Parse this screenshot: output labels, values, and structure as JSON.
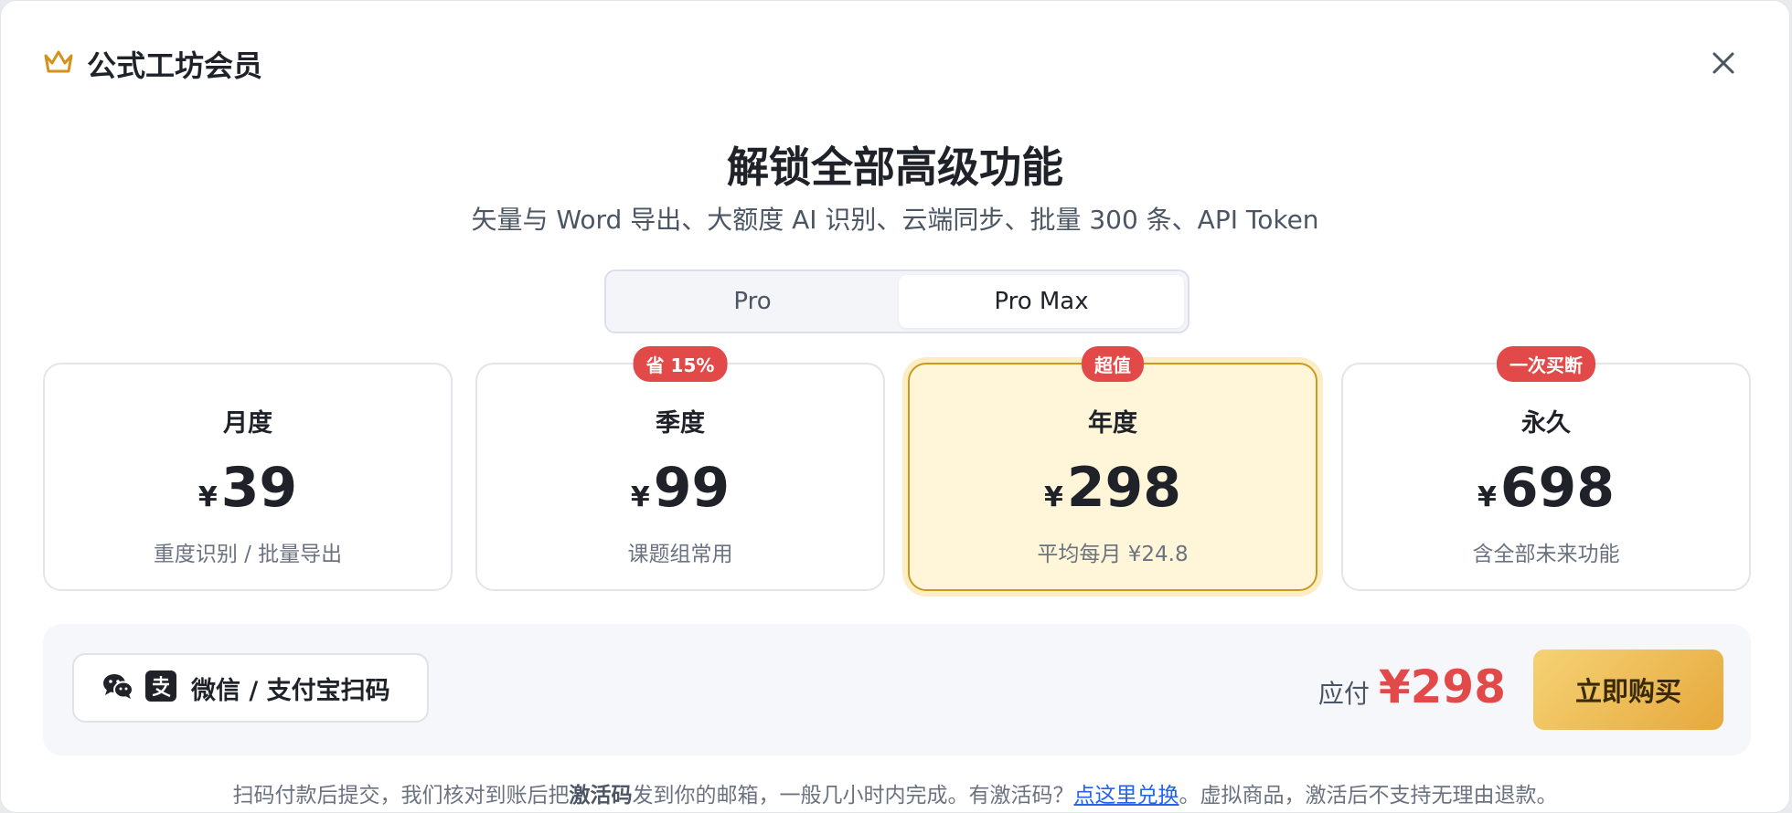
{
  "header": {
    "title": "公式工坊会员",
    "icon": "crown-icon",
    "accent": "#d4921a"
  },
  "hero": {
    "title": "解锁全部高级功能",
    "subtitle": "矢量与 Word 导出、大额度 AI 识别、云端同步、批量 300 条、API Token"
  },
  "tiers": [
    {
      "label": "Pro",
      "active": false
    },
    {
      "label": "Pro Max",
      "active": true
    }
  ],
  "plans": [
    {
      "name": "月度",
      "currency": "¥",
      "price": "39",
      "desc": "重度识别 / 批量导出",
      "badge": "",
      "selected": false
    },
    {
      "name": "季度",
      "currency": "¥",
      "price": "99",
      "desc": "课题组常用",
      "badge": "省 15%",
      "selected": false
    },
    {
      "name": "年度",
      "currency": "¥",
      "price": "298",
      "desc": "平均每月 ¥24.8",
      "badge": "超值",
      "selected": true
    },
    {
      "name": "永久",
      "currency": "¥",
      "price": "698",
      "desc": "含全部未来功能",
      "badge": "一次买断",
      "selected": false
    }
  ],
  "payment": {
    "method_label": "微信 / 支付宝扫码",
    "icons": [
      "wechat-icon",
      "alipay-icon"
    ],
    "due_label": "应付",
    "due_amount": "¥298",
    "buy_label": "立即购买"
  },
  "footnote": {
    "part1": "扫码付款后提交，我们核对到账后把",
    "bold": "激活码",
    "part2": "发到你的邮箱，一般几小时内完成。有激活码？",
    "link": "点这里兑换",
    "part3": "。虚拟商品，激活后不支持无理由退款。"
  },
  "colors": {
    "badge": "#e24a4a",
    "selected_bg": "#fff6d9",
    "selected_border": "#c99a1f",
    "price_due": "#e24a4a",
    "buy_gradient_start": "#f5d274",
    "buy_gradient_end": "#e6a93d",
    "link": "#2563eb"
  }
}
